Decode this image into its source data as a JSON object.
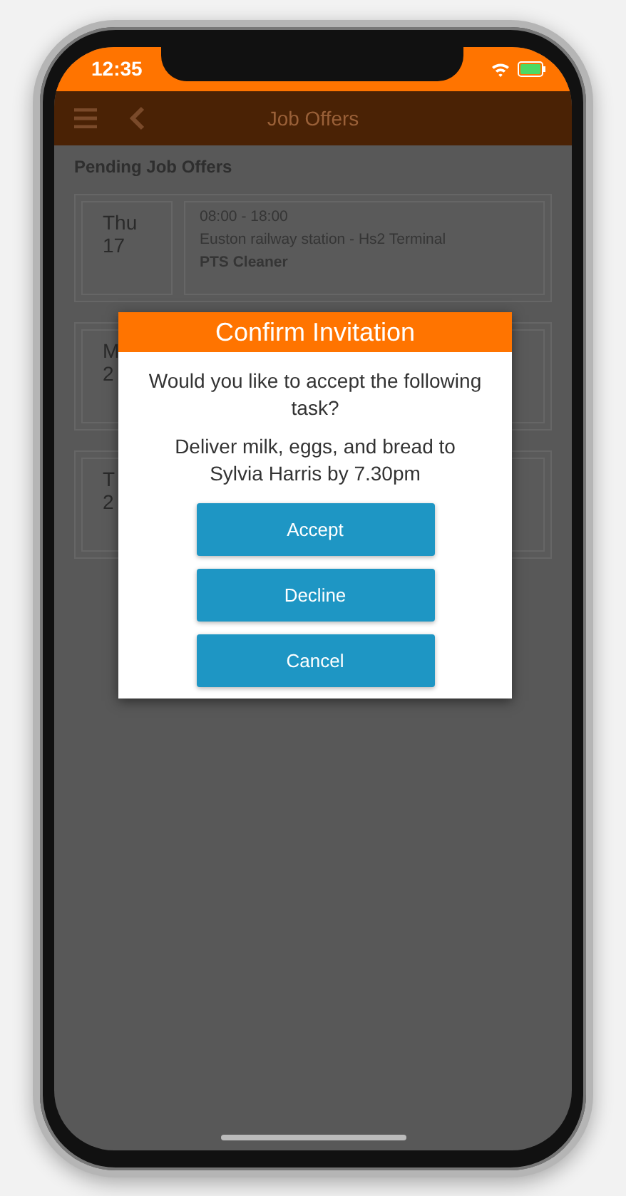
{
  "status_bar": {
    "time": "12:35"
  },
  "nav_bar": {
    "title": "Job Offers"
  },
  "section_title": "Pending Job Offers",
  "offers": [
    {
      "day": "Thu",
      "date": "17",
      "time": "08:00 - 18:00",
      "location": "Euston railway station - Hs2 Terminal",
      "role": "PTS Cleaner"
    },
    {
      "day": "M",
      "date": "2"
    },
    {
      "day": "T",
      "date": "2"
    }
  ],
  "dialog": {
    "title": "Confirm Invitation",
    "question": "Would you like to accept the following task?",
    "task": "Deliver milk, eggs, and bread to Sylvia Harris by 7.30pm",
    "buttons": [
      "Accept",
      "Decline",
      "Cancel"
    ]
  }
}
